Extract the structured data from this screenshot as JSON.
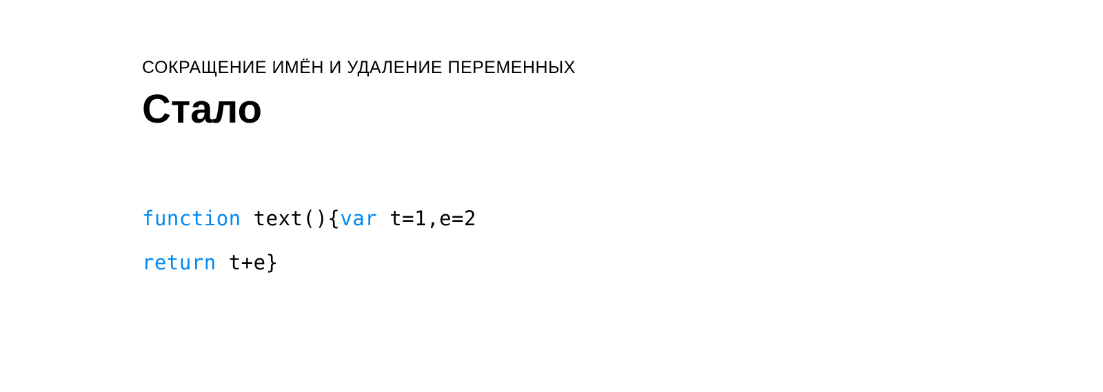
{
  "eyebrow": "СОКРАЩЕНИЕ ИМЁН И УДАЛЕНИЕ ПЕРЕМЕННЫХ",
  "title": "Стало",
  "code": {
    "line1": {
      "kw1": "function",
      "part1": " text(){",
      "kw2": "var",
      "part2": " t=1,e=2"
    },
    "line2": {
      "kw1": "return",
      "part1": " t+e}"
    }
  },
  "colors": {
    "keyword": "#0089f2",
    "text": "#000000",
    "background": "#ffffff"
  }
}
